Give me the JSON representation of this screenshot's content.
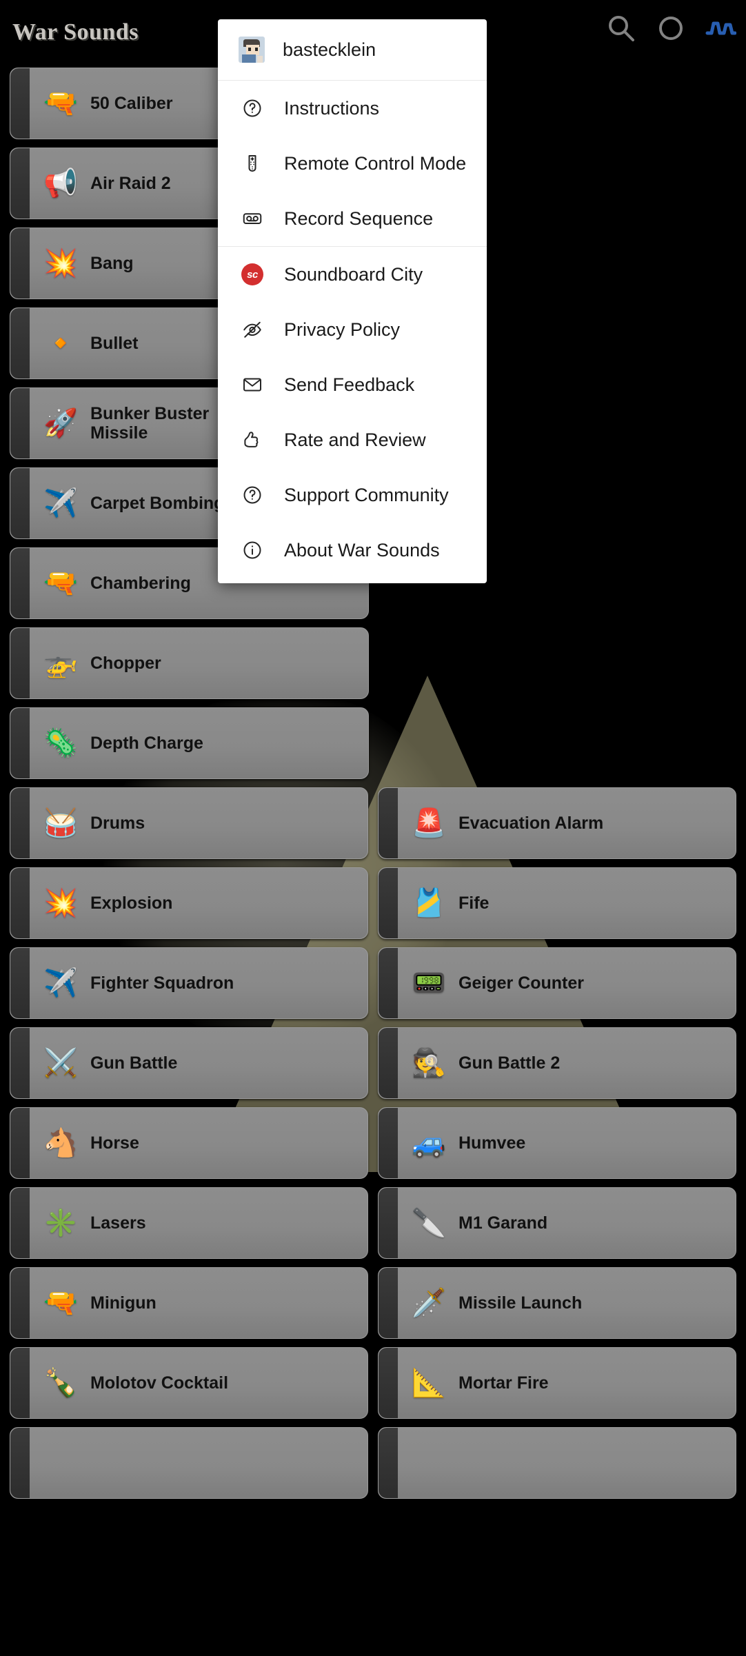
{
  "header": {
    "title": "War Sounds",
    "icons": [
      "search-icon",
      "record-circle-icon",
      "waveform-icon"
    ]
  },
  "menu": {
    "account": {
      "name": "bastecklein",
      "avatar_icon": "user-avatar"
    },
    "groups": [
      {
        "items": [
          {
            "label": "Instructions",
            "icon": "question-circle-icon"
          },
          {
            "label": "Remote Control Mode",
            "icon": "remote-control-icon"
          },
          {
            "label": "Record Sequence",
            "icon": "cassette-icon"
          }
        ]
      },
      {
        "items": [
          {
            "label": "Soundboard City",
            "icon": "sc-badge-icon"
          },
          {
            "label": "Privacy Policy",
            "icon": "eye-slash-icon"
          },
          {
            "label": "Send Feedback",
            "icon": "envelope-icon"
          },
          {
            "label": "Rate and Review",
            "icon": "thumbs-up-icon"
          },
          {
            "label": "Support Community",
            "icon": "question-circle-icon"
          },
          {
            "label": "About War Sounds",
            "icon": "info-circle-icon"
          }
        ]
      }
    ]
  },
  "colors": {
    "accent_red": "#d32f2f",
    "button_gray": "#898989",
    "background": "#000000",
    "beam": "#e9e2aa"
  },
  "sounds": {
    "single_column_rows": [
      {
        "label": "50 Caliber",
        "icon": "🔫"
      },
      {
        "label": "Air Raid 2",
        "icon": "📢"
      },
      {
        "label": "Bang",
        "icon": "💥"
      },
      {
        "label": "Bullet",
        "icon": "🔸"
      },
      {
        "label": "Bunker Buster Missile",
        "icon": "🚀"
      },
      {
        "label": "Carpet Bombing",
        "icon": "✈️"
      },
      {
        "label": "Chambering",
        "icon": "🔫"
      },
      {
        "label": "Chopper",
        "icon": "🚁"
      },
      {
        "label": "Depth Charge",
        "icon": "🦠"
      }
    ],
    "grid_rows": [
      [
        {
          "label": "Drums",
          "icon": "🥁"
        },
        {
          "label": "Evacuation Alarm",
          "icon": "🚨"
        }
      ],
      [
        {
          "label": "Explosion",
          "icon": "💥"
        },
        {
          "label": "Fife",
          "icon": "🎽"
        }
      ],
      [
        {
          "label": "Fighter Squadron",
          "icon": "✈️"
        },
        {
          "label": "Geiger Counter",
          "icon": "📟"
        }
      ],
      [
        {
          "label": "Gun Battle",
          "icon": "⚔️"
        },
        {
          "label": "Gun Battle 2",
          "icon": "🕵️"
        }
      ],
      [
        {
          "label": "Horse",
          "icon": "🐴"
        },
        {
          "label": "Humvee",
          "icon": "🚙"
        }
      ],
      [
        {
          "label": "Lasers",
          "icon": "✳️"
        },
        {
          "label": "M1 Garand",
          "icon": "🔪"
        }
      ],
      [
        {
          "label": "Minigun",
          "icon": "🔫"
        },
        {
          "label": "Missile Launch",
          "icon": "🗡️"
        }
      ],
      [
        {
          "label": "Molotov Cocktail",
          "icon": "🍾"
        },
        {
          "label": "Mortar Fire",
          "icon": "📐"
        }
      ],
      [
        {
          "label": "",
          "icon": ""
        },
        {
          "label": "",
          "icon": ""
        }
      ]
    ]
  }
}
